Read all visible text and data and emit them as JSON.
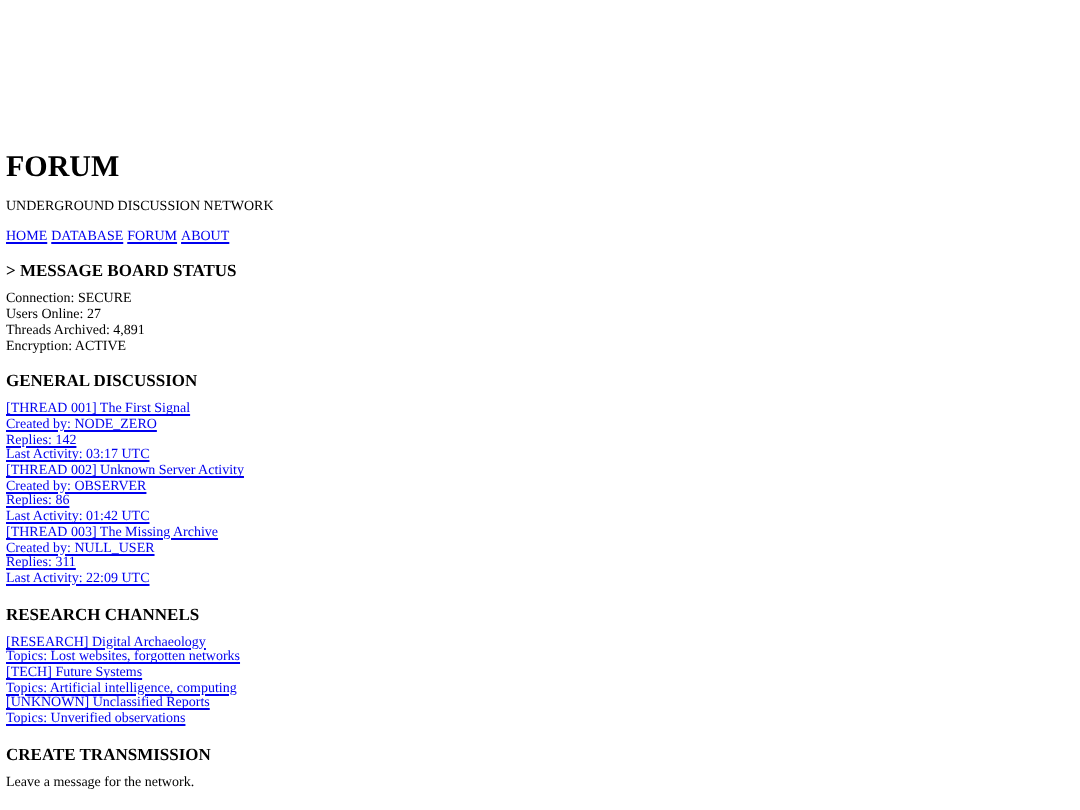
{
  "title": "FORUM",
  "subtitle": "UNDERGROUND DISCUSSION NETWORK",
  "nav": [
    "HOME",
    "DATABASE",
    "FORUM",
    "ABOUT"
  ],
  "status": {
    "heading": "> MESSAGE BOARD STATUS",
    "lines": [
      "Connection: SECURE",
      "Users Online: 27",
      "Threads Archived: 4,891",
      "Encryption: ACTIVE"
    ]
  },
  "general_discussion": {
    "heading": "GENERAL DISCUSSION",
    "threads": [
      {
        "title": "[THREAD 001] The First Signal",
        "created_by": "Created by: NODE_ZERO",
        "replies": "Replies: 142",
        "last_activity": "Last Activity: 03:17 UTC"
      },
      {
        "title": "[THREAD 002] Unknown Server Activity",
        "created_by": "Created by: OBSERVER",
        "replies": "Replies: 86",
        "last_activity": "Last Activity: 01:42 UTC"
      },
      {
        "title": "[THREAD 003] The Missing Archive",
        "created_by": "Created by: NULL_USER",
        "replies": "Replies: 311",
        "last_activity": "Last Activity: 22:09 UTC"
      }
    ]
  },
  "research_channels": {
    "heading": "RESEARCH CHANNELS",
    "channels": [
      {
        "title": "[RESEARCH] Digital Archaeology",
        "topics": "Topics: Lost websites, forgotten networks"
      },
      {
        "title": "[TECH] Future Systems",
        "topics": "Topics: Artificial intelligence, computing"
      },
      {
        "title": "[UNKNOWN] Unclassified Reports",
        "topics": "Topics: Unverified observations"
      }
    ]
  },
  "create_transmission": {
    "heading": "CREATE TRANSMISSION",
    "text": "Leave a message for the network."
  }
}
